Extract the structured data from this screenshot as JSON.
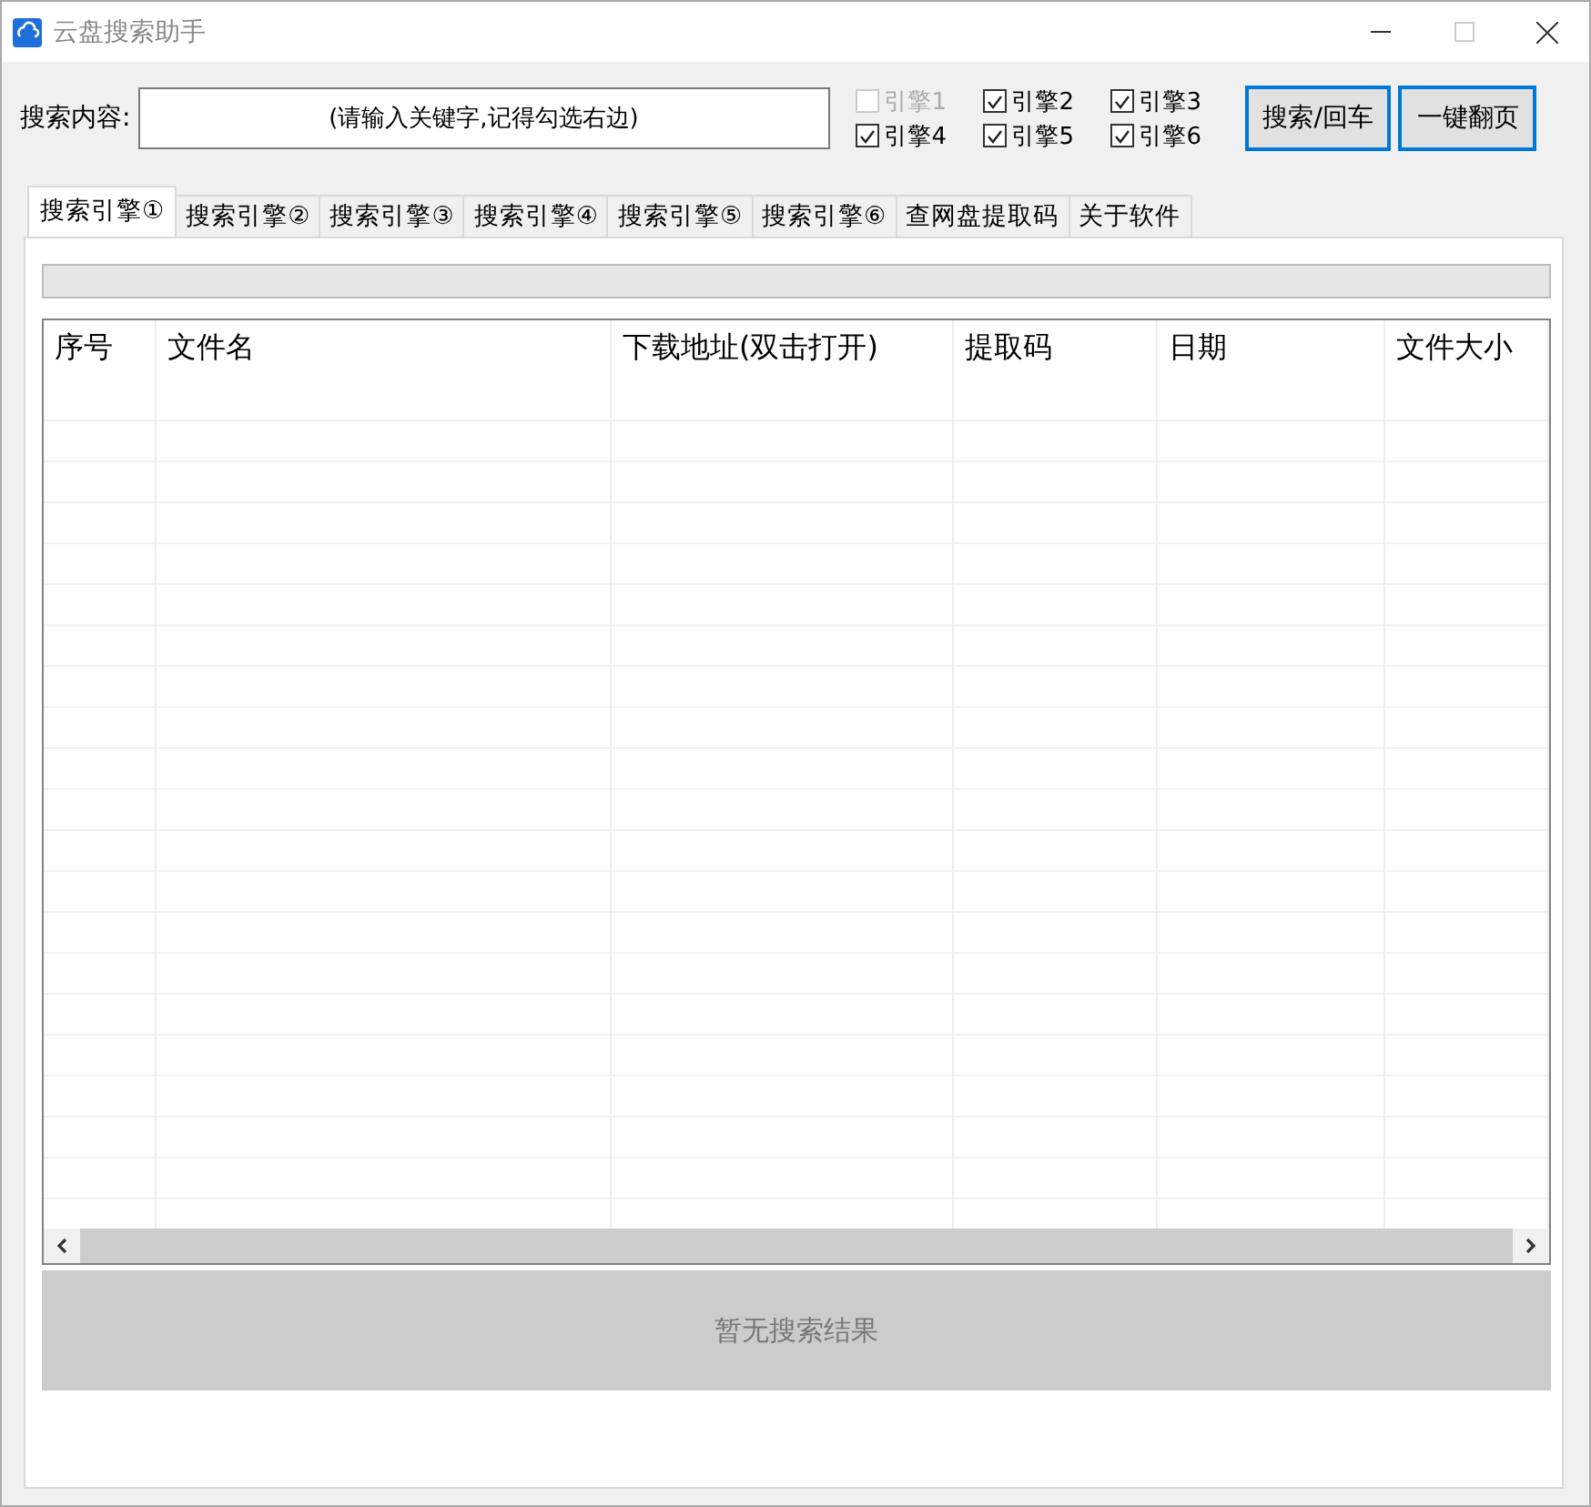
{
  "window": {
    "title": "云盘搜索助手"
  },
  "search": {
    "label": "搜索内容:",
    "value": "(请输入关键字,记得勾选右边)"
  },
  "engines": [
    {
      "label": "引擎1",
      "checked": false,
      "disabled": true
    },
    {
      "label": "引擎2",
      "checked": true,
      "disabled": false
    },
    {
      "label": "引擎3",
      "checked": true,
      "disabled": false
    },
    {
      "label": "引擎4",
      "checked": true,
      "disabled": false
    },
    {
      "label": "引擎5",
      "checked": true,
      "disabled": false
    },
    {
      "label": "引擎6",
      "checked": true,
      "disabled": false
    }
  ],
  "buttons": [
    "搜索/回车",
    "一键翻页"
  ],
  "tabs": [
    {
      "label": "搜索引擎①",
      "selected": true
    },
    {
      "label": "搜索引擎②",
      "selected": false
    },
    {
      "label": "搜索引擎③",
      "selected": false
    },
    {
      "label": "搜索引擎④",
      "selected": false
    },
    {
      "label": "搜索引擎⑤",
      "selected": false
    },
    {
      "label": "搜索引擎⑥",
      "selected": false
    },
    {
      "label": "查网盘提取码",
      "selected": false
    },
    {
      "label": "关于软件",
      "selected": false
    }
  ],
  "progress": {
    "level": 0
  },
  "table": {
    "columns": [
      "序号",
      "文件名",
      "下载地址(双击打开)",
      "提取码",
      "日期",
      "文件大小"
    ]
  },
  "status": "暂无搜索结果"
}
